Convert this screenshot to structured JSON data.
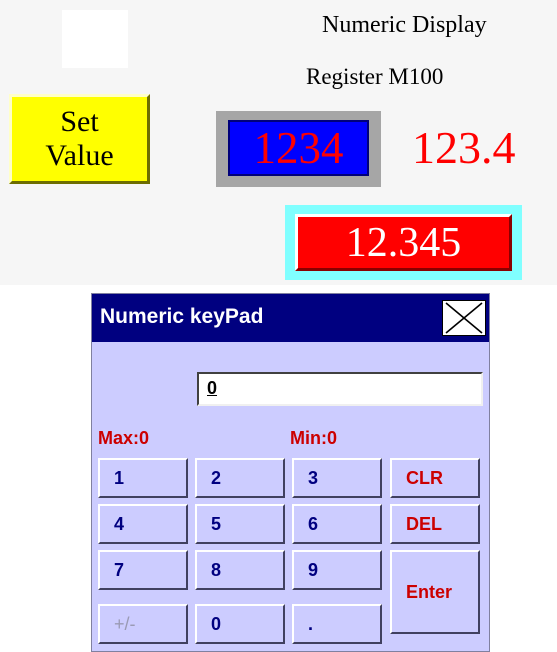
{
  "display": {
    "title": "Numeric Display",
    "register": "Register M100",
    "set_value_line1": "Set",
    "set_value_line2": "Value",
    "value_blue": "1234",
    "value_red_text": "123.4",
    "value_red_box": "12.345"
  },
  "keypad": {
    "title": "Numeric keyPad",
    "input_value": "0",
    "max_label": "Max:0",
    "min_label": "Min:0",
    "keys": {
      "k1": "1",
      "k2": "2",
      "k3": "3",
      "clr": "CLR",
      "k4": "4",
      "k5": "5",
      "k6": "6",
      "del": "DEL",
      "k7": "7",
      "k8": "8",
      "k9": "9",
      "enter": "Enter",
      "plusminus": "+/-",
      "k0": "0",
      "dot": "."
    }
  },
  "colors": {
    "set_button": "#ffff00",
    "blue_display": "#0000ff",
    "red_display": "#ff0000",
    "cyan_frame": "#80ffff",
    "keypad_title_bar": "#000080",
    "keypad_body": "#ccccff"
  }
}
